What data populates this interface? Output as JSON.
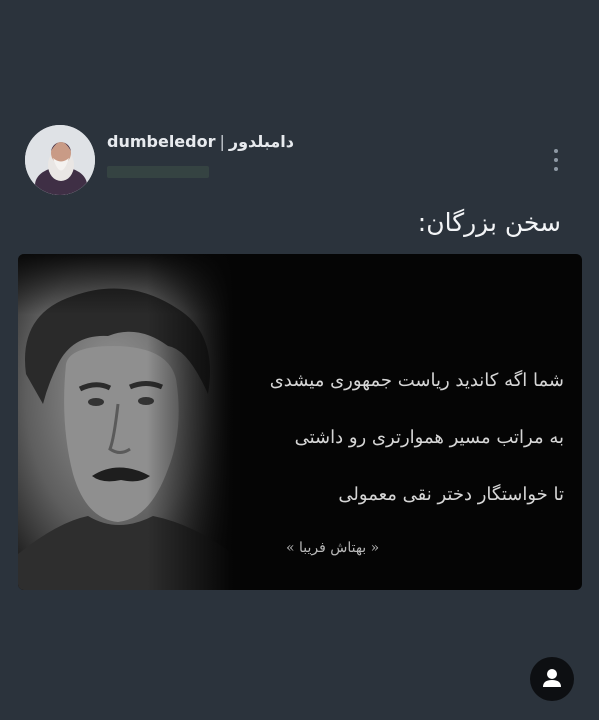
{
  "post": {
    "author": {
      "username": "dumbeledor",
      "separator": "|",
      "display_name": "دامبلدور"
    },
    "caption": "سخن بزرگان:",
    "media": {
      "quote_lines": [
        "شما اگه کاندید ریاست جمهوری میشدی",
        "به مراتب مسیر هموارتری رو داشتی",
        "تا خواستگار دختر نقی معمولی"
      ],
      "quote_author": "« بهتاش فریبا »"
    }
  },
  "icons": {
    "more": "more-vertical-icon",
    "profile": "person-icon"
  },
  "colors": {
    "background": "#2b333c",
    "text": "#e7eaee",
    "media_background": "#050505",
    "fab": "#0d0f12"
  }
}
